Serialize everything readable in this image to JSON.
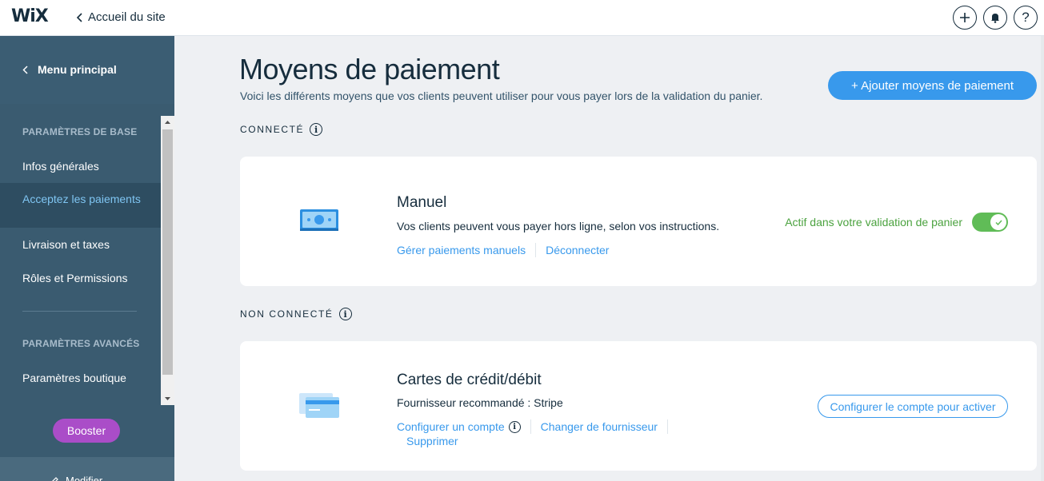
{
  "topbar": {
    "logo": "WiX",
    "back_label": "Accueil du site",
    "icons": [
      "plus-icon",
      "bell-icon",
      "help-icon"
    ],
    "help_glyph": "?"
  },
  "sidebar": {
    "back_label": "Menu principal",
    "section_basic": "PARAMÈTRES DE BASE",
    "items": [
      {
        "label": "Infos générales"
      },
      {
        "label": "Acceptez les paiements",
        "active": true
      },
      {
        "label": "Livraison et taxes"
      },
      {
        "label": "Rôles et Permissions"
      }
    ],
    "section_advanced": "PARAMÈTRES AVANCÉS",
    "advanced_items": [
      {
        "label": "Paramètres boutique"
      }
    ],
    "booster_label": "Booster",
    "modifier_label": "Modifier"
  },
  "main": {
    "title": "Moyens de paiement",
    "subtitle": "Voici les différents moyens que vos clients peuvent utiliser pour vous payer lors de la validation du panier.",
    "add_button": "+ Ajouter moyens de paiement",
    "connected_label": "CONNECTÉ",
    "not_connected_label": "NON CONNECTÉ",
    "info_glyph": "i",
    "manual": {
      "title": "Manuel",
      "description": "Vos clients peuvent vous payer hors ligne, selon vos instructions.",
      "link_manage": "Gérer paiements manuels",
      "link_disconnect": "Déconnecter",
      "status": "Actif dans votre validation de panier",
      "toggle_on": true
    },
    "cards": {
      "title": "Cartes de crédit/débit",
      "provider": "Fournisseur recommandé : Stripe",
      "link_configure": "Configurer un compte",
      "link_change": "Changer de fournisseur",
      "link_delete": "Supprimer",
      "configure_button": "Configurer le compte pour activer"
    }
  },
  "colors": {
    "accent": "#3899ec",
    "active_green": "#60bc57",
    "sidebar": "#3a5b70",
    "booster": "#aa4dc8"
  }
}
